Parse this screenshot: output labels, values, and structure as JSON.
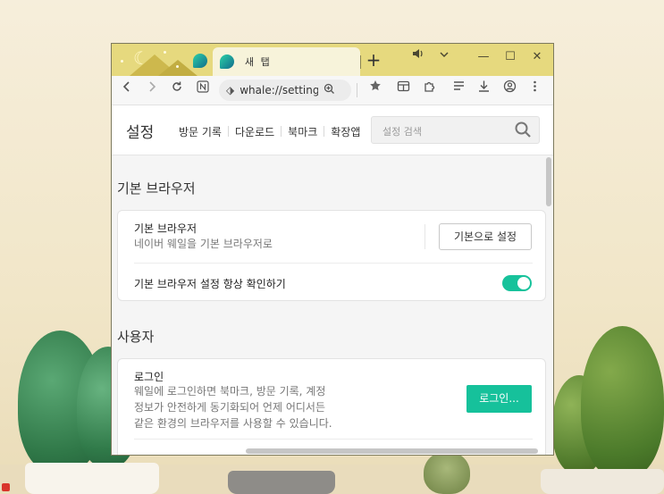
{
  "window": {
    "tabs": [
      {
        "title": "",
        "active": false
      },
      {
        "title": "새 탭",
        "active": true
      }
    ],
    "new_tab_label": "+",
    "controls": {
      "sound": "speaker-icon",
      "menu": "chevron-down-icon",
      "minimize": "—",
      "maximize": "☐",
      "close": "✕"
    }
  },
  "toolbar": {
    "address": "whale://settings",
    "address_icon": "whale-icon"
  },
  "settings": {
    "title": "설정",
    "nav": [
      "방문 기록",
      "다운로드",
      "북마크",
      "확장앱"
    ],
    "search_placeholder": "설정 검색",
    "sections": {
      "default_browser": {
        "title": "기본 브라우저",
        "row_title": "기본 브라우저",
        "row_desc": "네이버 웨일을 기본 브라우저로",
        "button": "기본으로 설정",
        "check_label": "기본 브라우저 설정 항상 확인하기",
        "check_enabled": true
      },
      "user": {
        "title": "사용자",
        "login_title": "로그인",
        "login_desc_1": "웨일에 로그인하면 북마크, 방문 기록, 계정",
        "login_desc_2": "정보가 안전하게 동기화되어 언제 어디서든",
        "login_desc_3": "같은 환경의 브라우저를 사용할 수 있습니다.",
        "login_button": "로그인..."
      }
    }
  },
  "colors": {
    "accent": "#16c19b",
    "titlebar": "#e6d97e"
  }
}
